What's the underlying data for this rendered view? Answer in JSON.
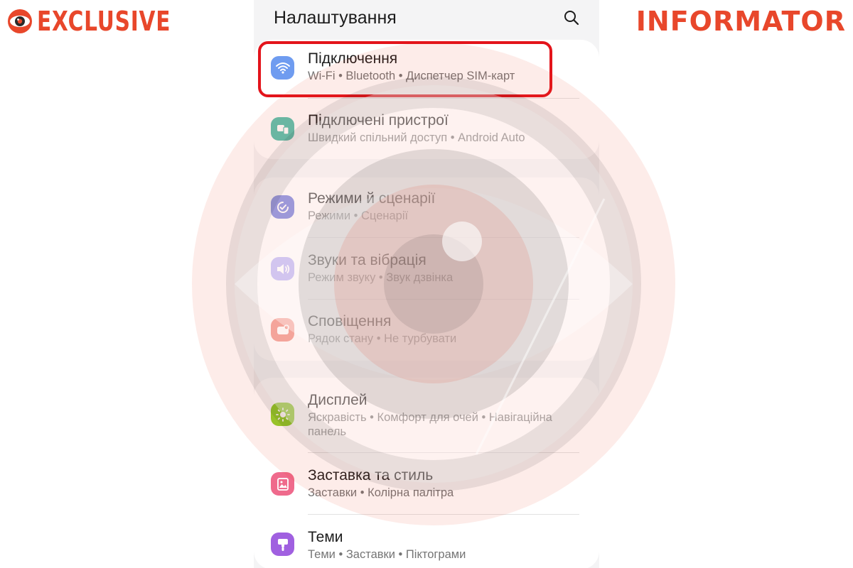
{
  "branding": {
    "left_logo_text": "EXCLUSIVE",
    "right_logo_text": "INFORMATOR",
    "brand_color": "#e8472b"
  },
  "header": {
    "title": "Налаштування",
    "search_icon": "search-icon"
  },
  "settings": [
    {
      "title": "Підключення",
      "subtitle": "Wi-Fi  •  Bluetooth  •  Диспетчер SIM-карт",
      "icon": "wifi-icon",
      "icon_color": "#6f9cf0",
      "highlighted": true
    },
    {
      "title": "Підключені пристрої",
      "subtitle": "Швидкий спільний доступ  •  Android Auto",
      "icon": "connected-devices-icon",
      "icon_color": "#5cc3b0"
    },
    {
      "title": "Режими й сценарії",
      "subtitle": "Режими  •  Сценарії",
      "icon": "modes-check-icon",
      "icon_color": "#5b66d6"
    },
    {
      "title": "Звуки та вібрація",
      "subtitle": "Режим звуку  •  Звук дзвінка",
      "icon": "sound-icon",
      "icon_color": "#8c7ff0"
    },
    {
      "title": "Сповіщення",
      "subtitle": "Рядок стану  •  Не турбувати",
      "icon": "notification-icon",
      "icon_color": "#ef7a6b"
    },
    {
      "title": "Дисплей",
      "subtitle": "Яскравість  •  Комфорт для очей  •  Навігаційна панель",
      "icon": "sun-icon",
      "icon_color": "#8fd12a"
    },
    {
      "title": "Заставка та стиль",
      "subtitle": "Заставки  •  Колірна палітра",
      "icon": "wallpaper-icon",
      "icon_color": "#ef6a8c"
    },
    {
      "title": "Теми",
      "subtitle": "Теми  •  Заставки  •  Піктограми",
      "icon": "theme-brush-icon",
      "icon_color": "#a060e0"
    }
  ],
  "highlight_color": "#e3141b"
}
